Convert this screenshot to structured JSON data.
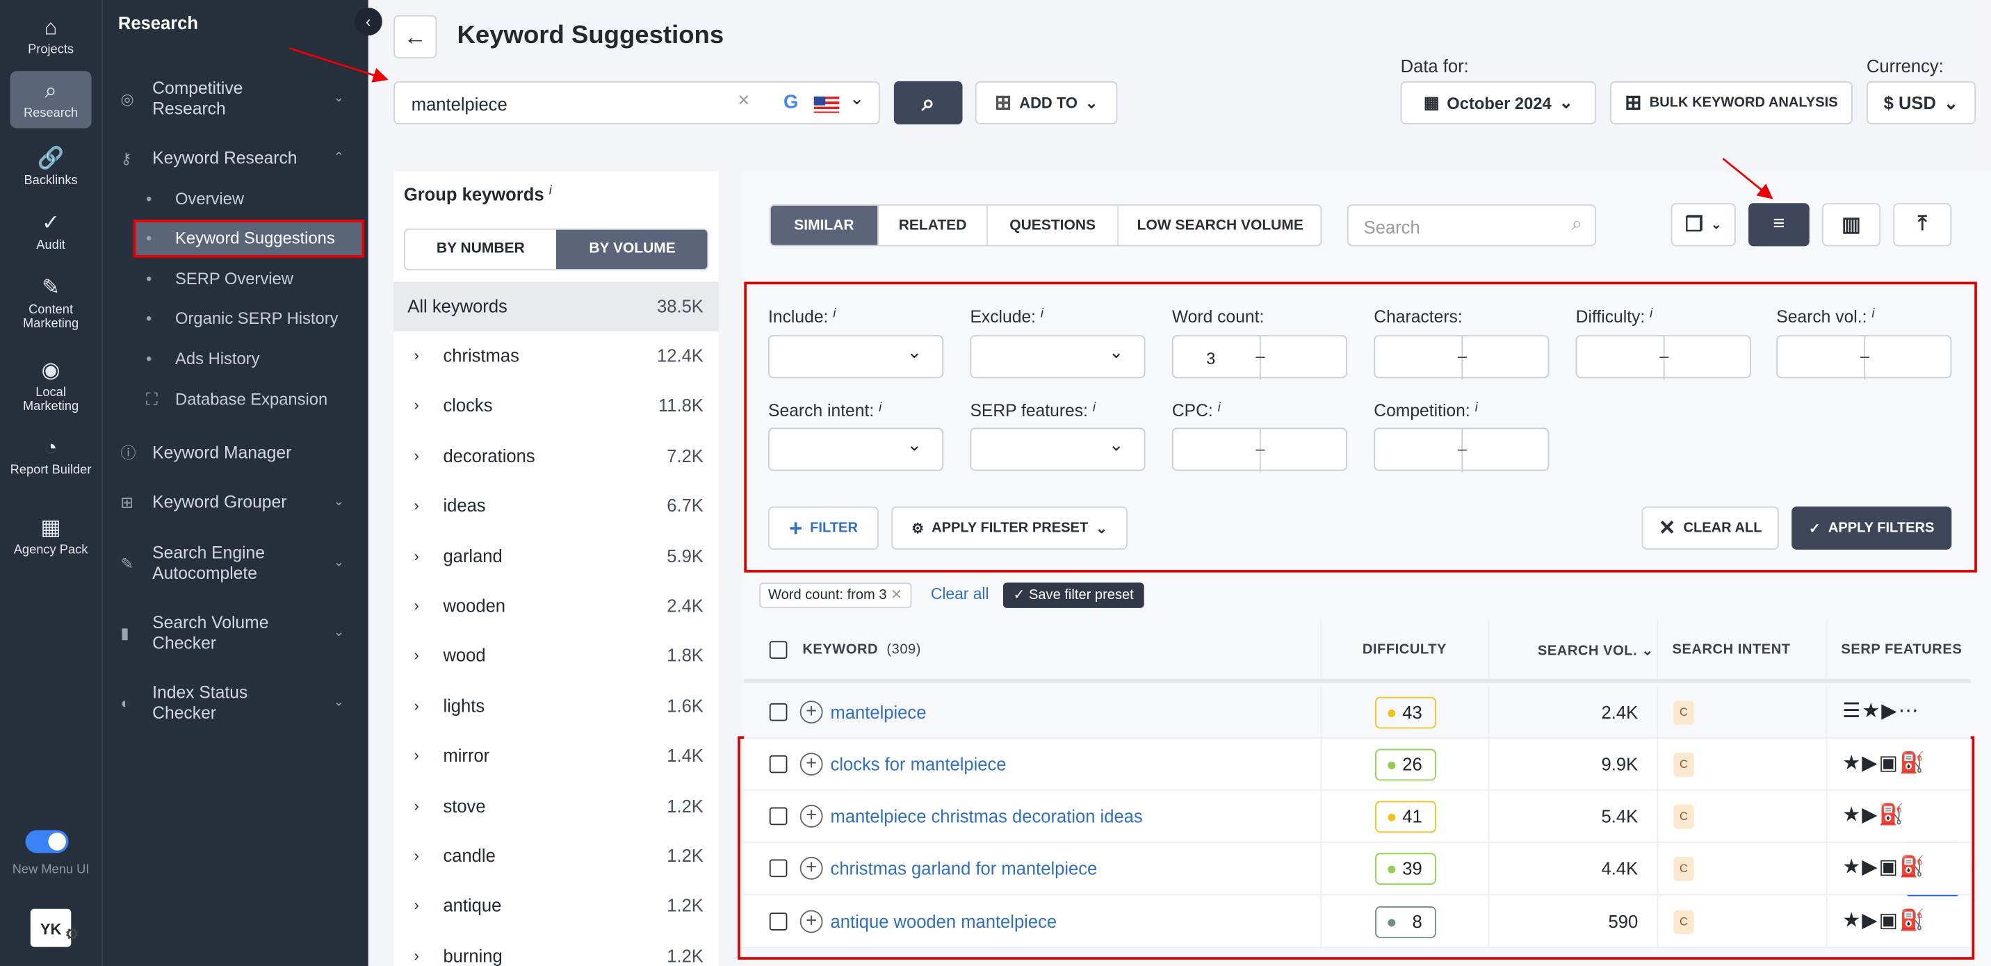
{
  "rail": {
    "items": [
      {
        "label": "Projects",
        "icon": "home-icon",
        "glyph": "⌂"
      },
      {
        "label": "Research",
        "icon": "research-icon",
        "glyph": "⌕",
        "active": true
      },
      {
        "label": "Backlinks",
        "icon": "link-icon",
        "glyph": "🔗"
      },
      {
        "label": "Audit",
        "icon": "check-circle-icon",
        "glyph": "✓"
      },
      {
        "label": "Content Marketing",
        "icon": "edit-icon",
        "glyph": "✎"
      },
      {
        "label": "Local Marketing",
        "icon": "location-icon",
        "glyph": "◉"
      },
      {
        "label": "Report Builder",
        "icon": "pie-chart-icon",
        "glyph": "◔"
      },
      {
        "label": "Agency Pack",
        "icon": "building-icon",
        "glyph": "▦"
      }
    ],
    "toggle_label": "New Menu UI",
    "toggle_on": true,
    "avatar": "YK"
  },
  "nav": {
    "title": "Research",
    "items": [
      {
        "label": "Competitive Research",
        "icon": "target-icon",
        "chev": "⌄"
      },
      {
        "label": "Keyword Research",
        "icon": "key-icon",
        "chev": "⌃"
      },
      {
        "label": "Keyword Manager",
        "icon": "manager-icon"
      },
      {
        "label": "Keyword Grouper",
        "icon": "folder-icon",
        "chev": "⌄"
      },
      {
        "label": "Search Engine Autocomplete",
        "icon": "pencil-icon",
        "chev": "⌄"
      },
      {
        "label": "Search Volume Checker",
        "icon": "bar-chart-icon",
        "chev": "⌄"
      },
      {
        "label": "Index Status Checker",
        "icon": "gauge-icon",
        "chev": "⌄"
      }
    ],
    "sub": [
      "Overview",
      "Keyword Suggestions",
      "SERP Overview",
      "Organic SERP History",
      "Ads History",
      "Database Expansion"
    ],
    "active_sub": "Keyword Suggestions"
  },
  "header": {
    "title": "Keyword Suggestions",
    "search_value": "mantelpiece",
    "add_to": "ADD TO",
    "data_for_label": "Data for:",
    "date": "October 2024",
    "bulk": "BULK KEYWORD ANALYSIS",
    "currency_label": "Currency:",
    "currency": "$ USD"
  },
  "group": {
    "title": "Group keywords",
    "toggle": [
      "BY NUMBER",
      "BY VOLUME"
    ],
    "active_toggle": "BY VOLUME",
    "all": {
      "name": "All keywords",
      "count": "38.5K"
    },
    "items": [
      {
        "name": "christmas",
        "count": "12.4K"
      },
      {
        "name": "clocks",
        "count": "11.8K"
      },
      {
        "name": "decorations",
        "count": "7.2K"
      },
      {
        "name": "ideas",
        "count": "6.7K"
      },
      {
        "name": "garland",
        "count": "5.9K"
      },
      {
        "name": "wooden",
        "count": "2.4K"
      },
      {
        "name": "wood",
        "count": "1.8K"
      },
      {
        "name": "lights",
        "count": "1.6K"
      },
      {
        "name": "mirror",
        "count": "1.4K"
      },
      {
        "name": "stove",
        "count": "1.2K"
      },
      {
        "name": "candle",
        "count": "1.2K"
      },
      {
        "name": "antique",
        "count": "1.2K"
      },
      {
        "name": "burning",
        "count": "1.2K"
      }
    ]
  },
  "tabs": [
    "SIMILAR",
    "RELATED",
    "QUESTIONS",
    "LOW SEARCH VOLUME"
  ],
  "active_tab": "SIMILAR",
  "table_search_placeholder": "Search",
  "filters": {
    "include": "Include:",
    "exclude": "Exclude:",
    "word_count": "Word count:",
    "word_count_value": "3",
    "characters": "Characters:",
    "difficulty": "Difficulty:",
    "search_vol": "Search vol.:",
    "search_intent": "Search intent:",
    "serp_features": "SERP features:",
    "cpc": "CPC:",
    "competition": "Competition:",
    "filter_btn": "FILTER",
    "preset_btn": "APPLY FILTER PRESET",
    "clear_all": "CLEAR ALL",
    "apply": "APPLY FILTERS"
  },
  "chips": {
    "chip": "Word count:",
    "chip_value": "from 3",
    "clear": "Clear all",
    "save": "Save filter preset"
  },
  "table": {
    "headers": {
      "keyword": "KEYWORD",
      "count": "(309)",
      "difficulty": "DIFFICULTY",
      "volume": "SEARCH VOL.",
      "intent": "SEARCH INTENT",
      "serp": "SERP FEATURES"
    },
    "rows": [
      {
        "keyword": "mantelpiece",
        "difficulty": "43",
        "diff_color": "#f0c419",
        "volume": "2.4K",
        "intent": "C",
        "serp": "☰★▶⋯"
      },
      {
        "keyword": "clocks for mantelpiece",
        "difficulty": "26",
        "diff_color": "#8fd14f",
        "volume": "9.9K",
        "intent": "C",
        "serp": "★▶▣⛽"
      },
      {
        "keyword": "mantelpiece christmas decoration ideas",
        "difficulty": "41",
        "diff_color": "#f0c419",
        "volume": "5.4K",
        "intent": "C",
        "serp": "★▶⛽"
      },
      {
        "keyword": "christmas garland for mantelpiece",
        "difficulty": "39",
        "diff_color": "#8fd14f",
        "volume": "4.4K",
        "intent": "C",
        "serp": "★▶▣⛽"
      },
      {
        "keyword": "antique wooden mantelpiece",
        "difficulty": "8",
        "diff_color": "#6d8f84",
        "volume": "590",
        "intent": "C",
        "serp": "★▶▣⛽"
      }
    ]
  }
}
